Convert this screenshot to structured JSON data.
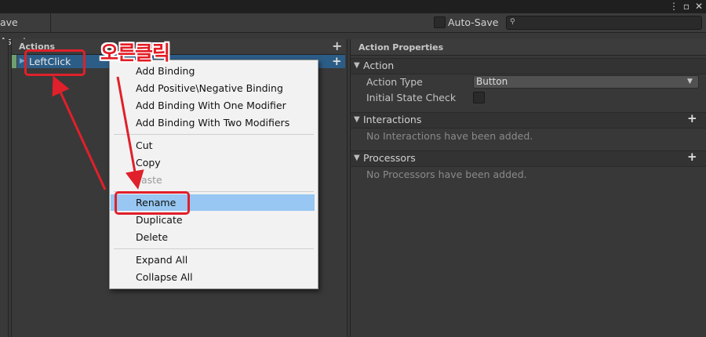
{
  "toolbar": {
    "save_asset_label": "ave Asset",
    "autosave_label": "Auto-Save",
    "search_icon": "search-icon"
  },
  "actions_pane": {
    "title": "Actions",
    "add_icon": "plus-icon",
    "selected_action": "LeftClick"
  },
  "properties_pane": {
    "title": "Action Properties",
    "action_section": {
      "title": "Action",
      "action_type_label": "Action Type",
      "action_type_value": "Button",
      "initial_state_label": "Initial State Check",
      "initial_state_checked": false
    },
    "interactions_section": {
      "title": "Interactions",
      "empty_text": "No Interactions have been added."
    },
    "processors_section": {
      "title": "Processors",
      "empty_text": "No Processors have been added."
    }
  },
  "context_menu": {
    "items": [
      {
        "label": "Add Binding",
        "enabled": true
      },
      {
        "label": "Add Positive\\Negative Binding",
        "enabled": true
      },
      {
        "label": "Add Binding With One Modifier",
        "enabled": true
      },
      {
        "label": "Add Binding With Two Modifiers",
        "enabled": true
      },
      {
        "label": "Cut",
        "enabled": true
      },
      {
        "label": "Copy",
        "enabled": true
      },
      {
        "label": "Paste",
        "enabled": false
      },
      {
        "label": "Rename",
        "enabled": true,
        "highlighted": true
      },
      {
        "label": "Duplicate",
        "enabled": true
      },
      {
        "label": "Delete",
        "enabled": true
      },
      {
        "label": "Expand All",
        "enabled": true
      },
      {
        "label": "Collapse All",
        "enabled": true
      }
    ]
  },
  "annotation": {
    "text": "오른클릭",
    "color": "#e0202a"
  }
}
